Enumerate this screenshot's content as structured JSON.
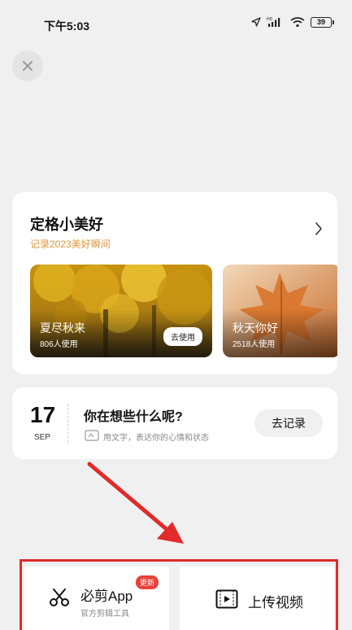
{
  "status_bar": {
    "time": "下午5:03",
    "battery": "39",
    "hd_label": "HD"
  },
  "icons": {
    "close": "close-icon",
    "chevron": "chevron-right-icon",
    "note_hint": "edit-note-icon",
    "bijian": "scissors-icon",
    "upload": "video-upload-icon"
  },
  "featured": {
    "title": "定格小美好",
    "subtitle": "记录2023美好瞬间",
    "templates": [
      {
        "name": "夏尽秋来",
        "count": "806人使用",
        "button": "去使用"
      },
      {
        "name": "秋天你好",
        "count": "2518人使用"
      }
    ]
  },
  "note": {
    "day": "17",
    "month": "SEP",
    "question": "你在想些什么呢?",
    "hint": "用文字，表达你的心情和状态",
    "button": "去记录"
  },
  "bottom": {
    "bijian": {
      "name": "必剪App",
      "badge": "更新",
      "desc": "官方剪辑工具"
    },
    "upload": {
      "label": "上传视频"
    }
  },
  "colors": {
    "background": "#f0f0f0",
    "accent_orange": "#e3963d",
    "annotation_red": "#e12a2a",
    "badge_red": "#e8413a"
  }
}
